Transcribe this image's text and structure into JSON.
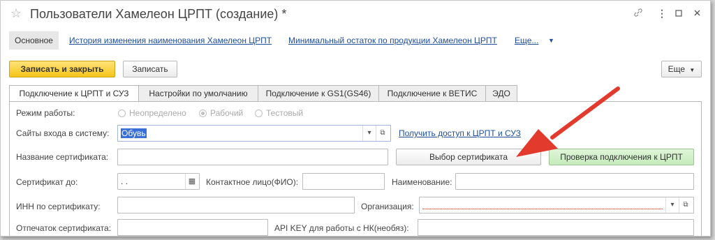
{
  "window": {
    "title": "Пользователи Хамелеон ЦРПТ (создание) *",
    "icons": {
      "star": "star-icon",
      "link": "link-icon",
      "more": "more-vertical-icon",
      "maximize": "maximize-icon",
      "close": "close-icon"
    }
  },
  "nav": {
    "items": [
      "Основное",
      "История изменения наименования Хамелеон ЦРПТ",
      "Минимальный остаток по продукции Хамелеон ЦРПТ",
      "Еще..."
    ]
  },
  "toolbar": {
    "save_close": "Записать и закрыть",
    "save": "Записать",
    "more": "Еще"
  },
  "tabs": [
    "Подключение к ЦРПТ и СУЗ",
    "Настройки по умолчанию",
    "Подключение к GS1(GS46)",
    "Подключение к ВЕТИС",
    "ЭДО"
  ],
  "form": {
    "mode_label": "Режим работы:",
    "mode_options": [
      "Неопределено",
      "Рабочий",
      "Тестовый"
    ],
    "mode_selected": "Рабочий",
    "sites_label": "Сайты входа в систему:",
    "sites_value": "Обувь",
    "access_link": "Получить доступ к ЦРПТ и СУЗ",
    "cert_name_label": "Название сертификата:",
    "cert_name_value": "",
    "choose_cert_button": "Выбор сертификата",
    "check_conn_button": "Проверка подключения к ЦРПТ",
    "cert_until_label": "Сертификат до:",
    "cert_until_value": " .  .",
    "contact_label": "Контактное лицо(ФИО):",
    "contact_value": "",
    "name_label": "Наименование:",
    "name_value": "",
    "inn_label": "ИНН по сертификату:",
    "inn_value": "",
    "org_label": "Организация:",
    "org_value": "",
    "thumb_label": "Отпечаток сертификата:",
    "thumb_value": "",
    "api_label": "API KEY для работы с НК(необяз):",
    "api_value": ""
  },
  "colors": {
    "primary": "#f5c518",
    "link": "#1f4e9c",
    "arrow": "#e23b2e",
    "check": "#c5ebbb"
  }
}
